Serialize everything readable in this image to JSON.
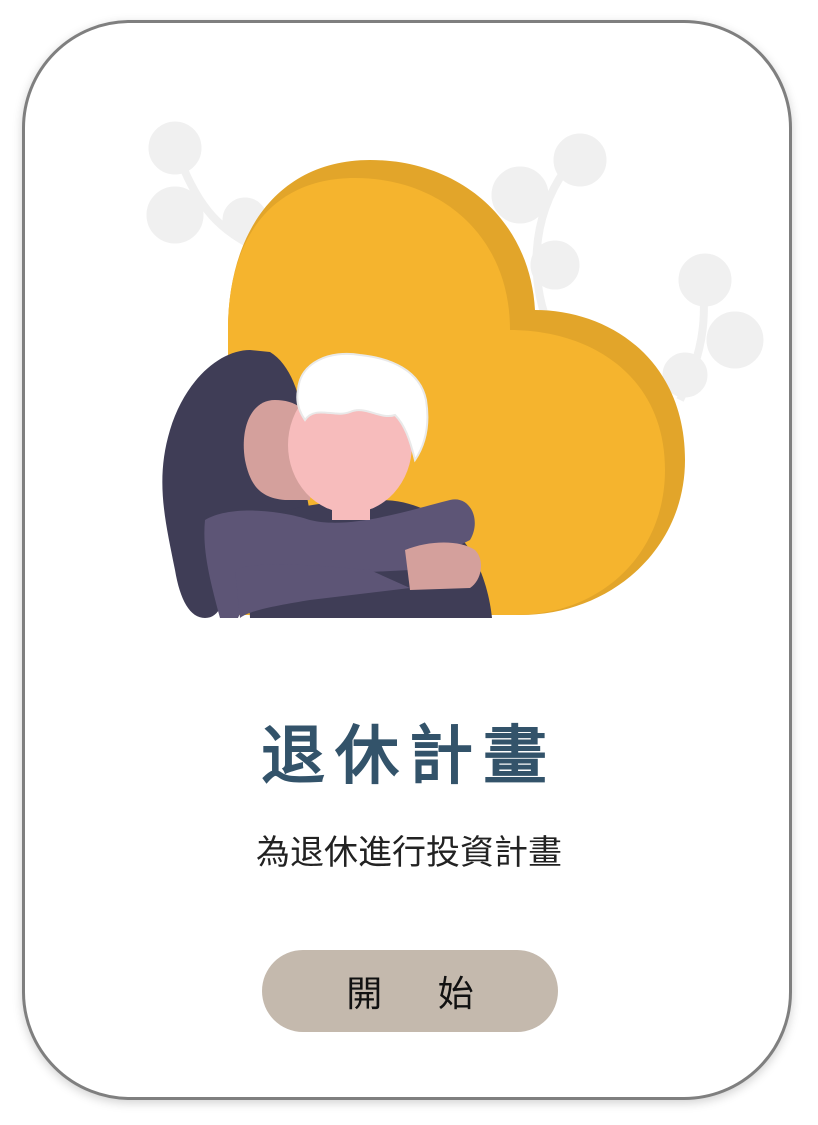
{
  "main": {
    "title": "退休計畫",
    "subtitle": "為退休進行投資計畫",
    "start_button_label": "開 始"
  },
  "illustration": {
    "icon": "retirement-hug-heart-illustration",
    "colors": {
      "heart": "#f5b42e",
      "heart_shadow": "#e2a52a",
      "leaves": "#f0f0f0",
      "hair_dark": "#3f3d56",
      "hair_white": "#ffffff",
      "skin": "#f7bcbc",
      "skin_shadow": "#d4a09c",
      "sweater": "#5d5576"
    }
  },
  "colors": {
    "title": "#33536a",
    "button_bg": "#c4b9ad",
    "card_border": "#7f7f7f"
  }
}
